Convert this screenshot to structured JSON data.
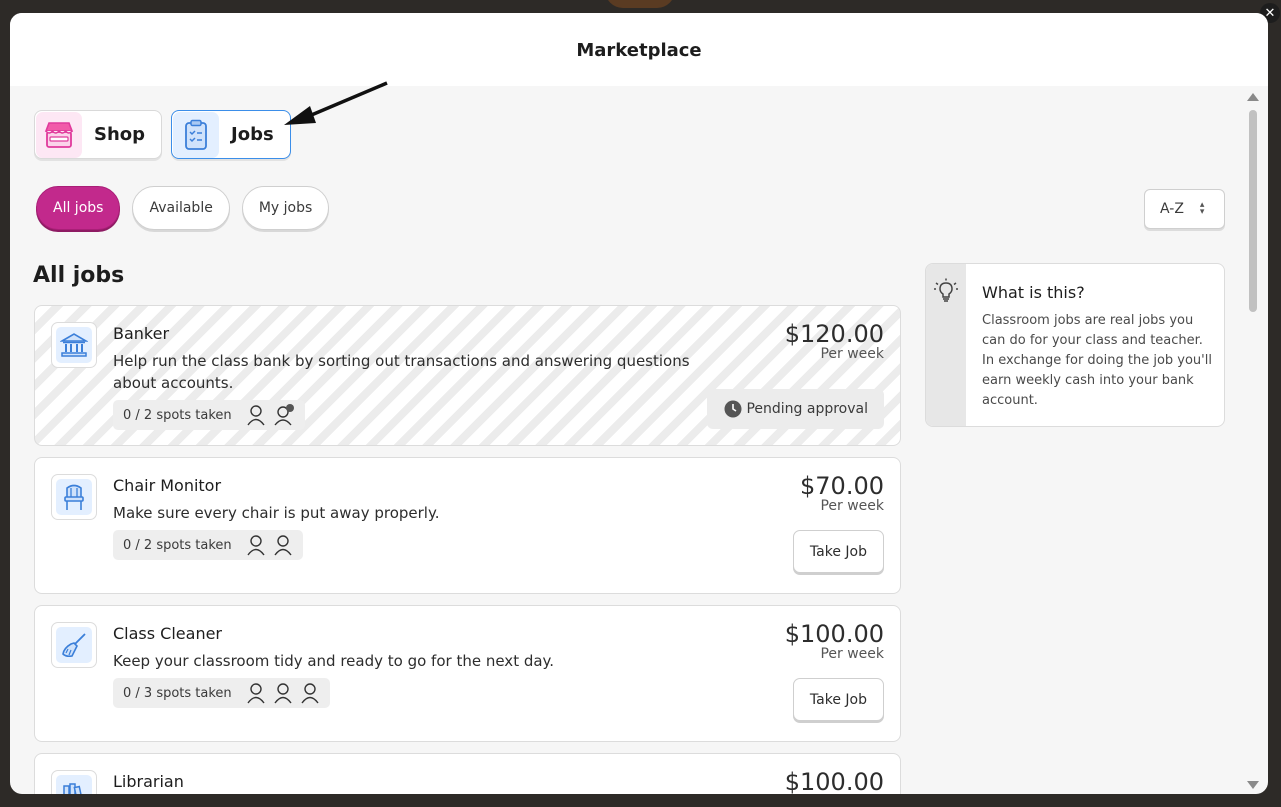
{
  "window": {
    "close_glyph": "✕"
  },
  "header": {
    "title": "Marketplace"
  },
  "tabs": [
    {
      "label": "Shop",
      "icon": "storefront-icon",
      "active": false
    },
    {
      "label": "Jobs",
      "icon": "clipboard-checklist-icon",
      "active": true
    }
  ],
  "filters": [
    {
      "label": "All jobs",
      "active": true
    },
    {
      "label": "Available",
      "active": false
    },
    {
      "label": "My jobs",
      "active": false
    }
  ],
  "sort": {
    "value": "A-Z"
  },
  "section_title": "All jobs",
  "jobs": [
    {
      "title": "Banker",
      "description": "Help run the class bank by sorting out transactions and answering questions about accounts.",
      "spots": "0 / 2 spots taken",
      "price": "$120.00",
      "period": "Per week",
      "status": "Pending approval",
      "icon": "bank-icon"
    },
    {
      "title": "Chair Monitor",
      "description": "Make sure every chair is put away properly.",
      "spots": "0 / 2 spots taken",
      "price": "$70.00",
      "period": "Per week",
      "action": "Take Job",
      "icon": "chair-icon"
    },
    {
      "title": "Class Cleaner",
      "description": "Keep your classroom tidy and ready to go for the next day.",
      "spots": "0 / 3 spots taken",
      "price": "$100.00",
      "period": "Per week",
      "action": "Take Job",
      "icon": "broom-icon"
    },
    {
      "title": "Librarian",
      "price": "$100.00",
      "icon": "books-icon"
    }
  ],
  "info": {
    "title": "What is this?",
    "text": "Classroom jobs are real jobs you can do for your class and teacher. In exchange for doing the job you'll earn weekly cash into your bank account."
  },
  "colors": {
    "accent_pink": "#c2298c",
    "accent_blue": "#3b8ee9"
  }
}
